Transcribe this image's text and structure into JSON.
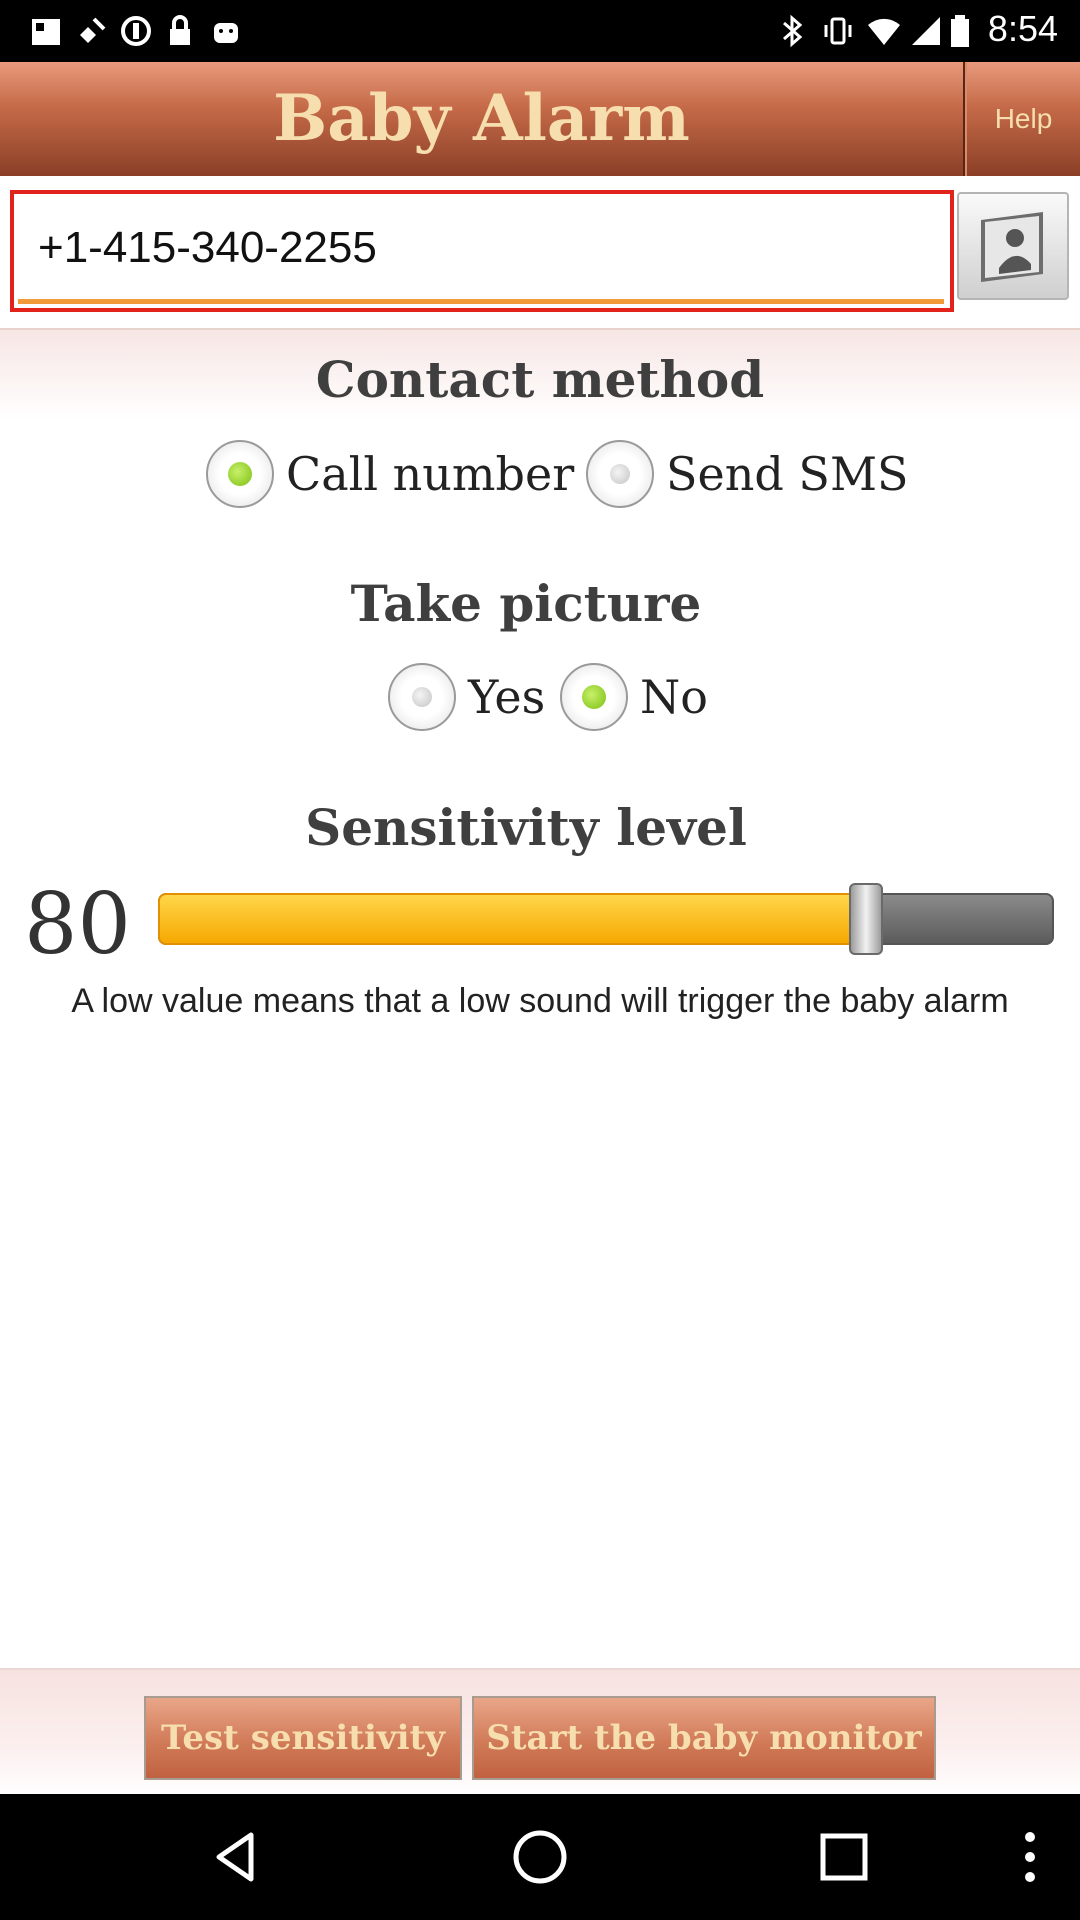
{
  "status_bar": {
    "time": "8:54"
  },
  "app_bar": {
    "title": "Baby Alarm",
    "help_label": "Help"
  },
  "phone": {
    "value": "+1-415-340-2255"
  },
  "contact_method": {
    "heading": "Contact method",
    "options": [
      {
        "label": "Call number",
        "selected": true
      },
      {
        "label": "Send SMS",
        "selected": false
      }
    ]
  },
  "take_picture": {
    "heading": "Take picture",
    "options": [
      {
        "label": "Yes",
        "selected": false
      },
      {
        "label": "No",
        "selected": true
      }
    ]
  },
  "sensitivity": {
    "heading": "Sensitivity level",
    "value": "80",
    "slider_fraction": 0.79,
    "hint": "A low value means that a low sound will trigger the baby alarm"
  },
  "footer": {
    "test_label": "Test sensitivity",
    "start_label": "Start the baby monitor"
  },
  "colors": {
    "app_bar": "#c56a48",
    "title_text": "#f7deae",
    "focus_border": "#e1231b",
    "input_underline": "#f09a3a",
    "slider_fill": "#f6a800",
    "radio_selected": "#7bbf12"
  }
}
